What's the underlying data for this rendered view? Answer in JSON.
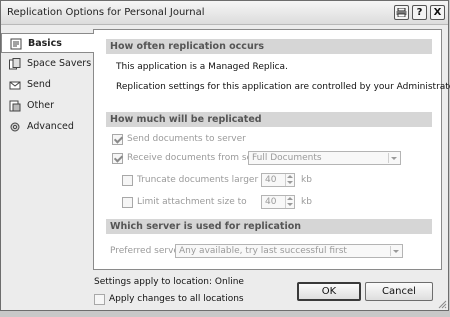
{
  "window": {
    "title": "Replication Options for Personal Journal",
    "buttons": [
      {
        "name": "print-icon",
        "glyph": "print"
      },
      {
        "name": "help-button",
        "glyph": "?"
      },
      {
        "name": "close-button",
        "glyph": "X"
      }
    ]
  },
  "sidebar": {
    "items": [
      {
        "label": "Basics",
        "icon": "basics-icon",
        "active": true
      },
      {
        "label": "Space Savers",
        "icon": "space-savers-icon",
        "active": false
      },
      {
        "label": "Send",
        "icon": "send-icon",
        "active": false
      },
      {
        "label": "Other",
        "icon": "other-icon",
        "active": false
      },
      {
        "label": "Advanced",
        "icon": "advanced-icon",
        "active": false
      }
    ]
  },
  "sections": {
    "how_often": {
      "heading": "How often replication occurs",
      "line1": "This application is a Managed Replica.",
      "line2": "Replication settings for this application are controlled by your Administrator"
    },
    "how_much": {
      "heading": "How much will be replicated",
      "send_docs": {
        "label": "Send documents to server",
        "checked": true
      },
      "receive_docs": {
        "label": "Receive documents from server",
        "checked": true,
        "select_value": "Full Documents"
      },
      "truncate": {
        "label": "Truncate documents larger than",
        "checked": false,
        "value": "40",
        "unit": "kb"
      },
      "limit_attach": {
        "label": "Limit attachment size to",
        "checked": false,
        "value": "40",
        "unit": "kb"
      }
    },
    "which_server": {
      "heading": "Which server is used for replication",
      "label": "Preferred server",
      "select_value": "Any available, try last successful first"
    }
  },
  "footer": {
    "location_text": "Settings apply to location: Online",
    "apply_all": {
      "label": "Apply changes to all locations",
      "checked": false
    },
    "ok_label": "OK",
    "cancel_label": "Cancel"
  }
}
